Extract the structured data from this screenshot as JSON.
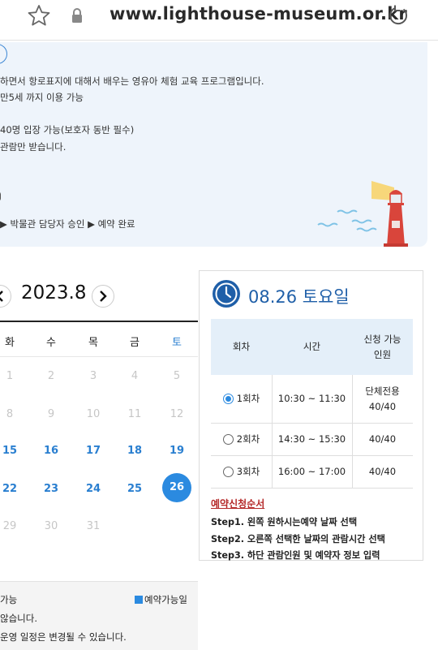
{
  "browser": {
    "url": "www.lighthouse-museum.or.kr"
  },
  "info": {
    "line1": "하면서 항로표지에 대해서 배우는 영유아 체험 교육 프로그램입니다.",
    "line2": "만5세 까지 이용 가능",
    "line3": "40명 입장 가능(보호자 동반 필수)",
    "line4": "관람만 받습니다.",
    "process": "▶ 박물관 담당자 승인 ▶ 예약 완료"
  },
  "calendar": {
    "year_month": "2023.8",
    "weekdays": [
      "화",
      "수",
      "목",
      "금",
      "토"
    ],
    "weeks": [
      [
        "1",
        "2",
        "3",
        "4",
        "5"
      ],
      [
        "8",
        "9",
        "10",
        "11",
        "12"
      ],
      [
        "15",
        "16",
        "17",
        "18",
        "19"
      ],
      [
        "22",
        "23",
        "24",
        "25",
        "26"
      ],
      [
        "29",
        "30",
        "31"
      ]
    ],
    "available_days": [
      "15",
      "16",
      "17",
      "18",
      "19",
      "22",
      "23",
      "24",
      "25",
      "26"
    ],
    "selected_day": "26",
    "accent_color": "#2b8ae0"
  },
  "legend": {
    "left_label": "가능",
    "available_label": "예약가능일",
    "note1": "않습니다.",
    "note2": "운영 일정은 변경될 수 있습니다."
  },
  "schedule": {
    "date_title": "08.26 토요일",
    "columns": [
      "회차",
      "시간",
      "신청 가능\n인원"
    ],
    "rows": [
      {
        "session": "1회차",
        "time": "10:30 ~ 11:30",
        "capacity": "단체전용\n40/40",
        "selected": true
      },
      {
        "session": "2회차",
        "time": "14:30 ~ 15:30",
        "capacity": "40/40",
        "selected": false
      },
      {
        "session": "3회차",
        "time": "16:00 ~ 17:00",
        "capacity": "40/40",
        "selected": false
      }
    ],
    "steps_title": "예약신청순서",
    "steps": [
      "Step1. 왼쪽 원하시는예약 날짜 선택",
      "Step2. 오른쪽 선택한 날짜의 관람시간 선택",
      "Step3. 하단 관람인원 및 예약자 정보 입력"
    ]
  }
}
